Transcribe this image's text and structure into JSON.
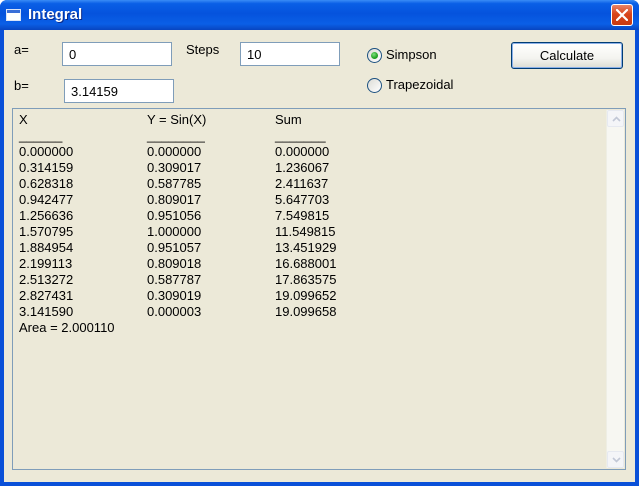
{
  "window": {
    "title": "Integral"
  },
  "form": {
    "a_label": "a=",
    "a_value": "0",
    "b_label": "b=",
    "b_value": "3.14159",
    "steps_label": "Steps",
    "steps_value": "10",
    "method_options": [
      {
        "label": "Simpson",
        "selected": true
      },
      {
        "label": "Trapezoidal",
        "selected": false
      }
    ],
    "calculate_label": "Calculate"
  },
  "output": {
    "headers": [
      "X",
      "Y = Sin(X)",
      "Sum"
    ],
    "separators": [
      "______",
      "________",
      "_______"
    ],
    "rows": [
      [
        "0.000000",
        "0.000000",
        "0.000000"
      ],
      [
        "0.314159",
        "0.309017",
        "1.236067"
      ],
      [
        "0.628318",
        "0.587785",
        "2.411637"
      ],
      [
        "0.942477",
        "0.809017",
        "5.647703"
      ],
      [
        "1.256636",
        "0.951056",
        "7.549815"
      ],
      [
        "1.570795",
        "1.000000",
        "11.549815"
      ],
      [
        "1.884954",
        "0.951057",
        "13.451929"
      ],
      [
        "2.199113",
        "0.809018",
        "16.688001"
      ],
      [
        "2.513272",
        "0.587787",
        "17.863575"
      ],
      [
        "2.827431",
        "0.309019",
        "19.099652"
      ],
      [
        "3.141590",
        "0.000003",
        "19.099658"
      ]
    ],
    "area_line": "Area = 2.000110"
  },
  "icons": {
    "window_icon": "window-icon",
    "close": "close-icon",
    "scroll_up": "arrow-up-icon",
    "scroll_down": "arrow-down-icon"
  },
  "colors": {
    "titlebar": "#0553dd",
    "client": "#ece9d8",
    "close_button": "#d9441a",
    "radio_selected": "#21a121"
  }
}
